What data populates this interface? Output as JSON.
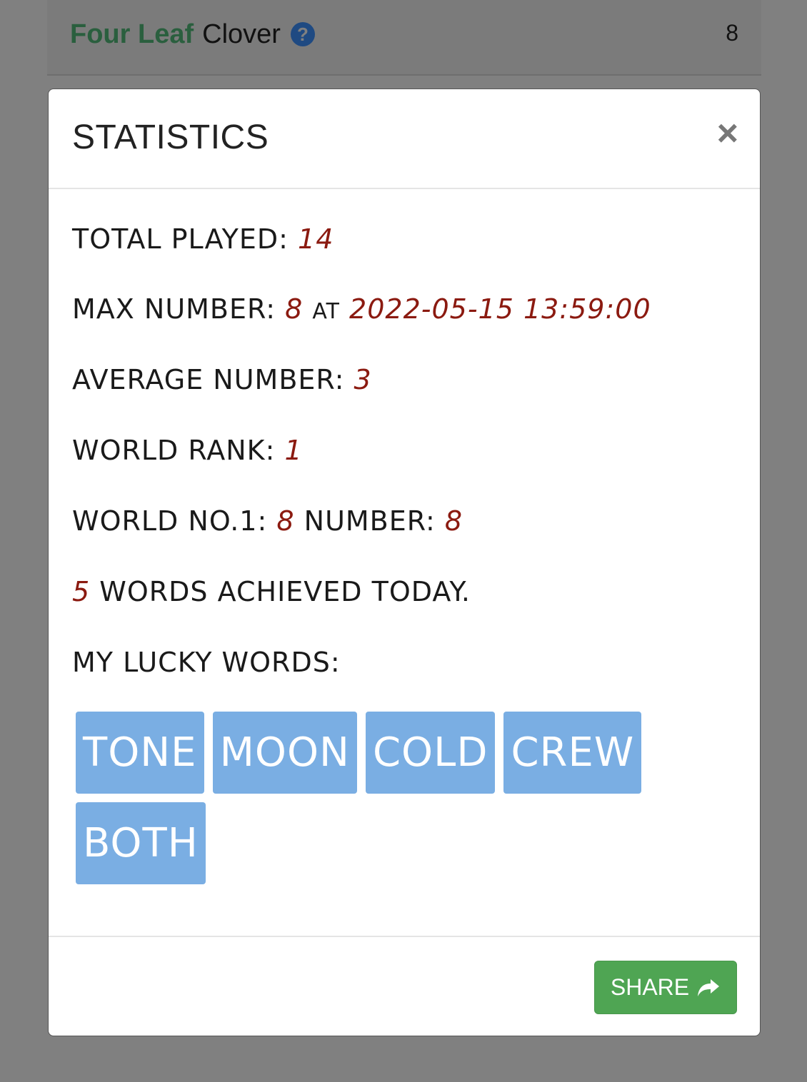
{
  "header": {
    "title_green": "Four Leaf",
    "title_dark": "Clover",
    "help_icon": "question-circle-icon",
    "count": "8"
  },
  "modal": {
    "title": "STATISTICS",
    "close_label": "×",
    "stats": {
      "total_played_label": "Total Played:",
      "total_played_value": "14",
      "max_number_label": "Max Number:",
      "max_number_value": "8",
      "max_number_at": "at",
      "max_number_datetime": "2022-05-15 13:59:00",
      "average_number_label": "Average Number:",
      "average_number_value": "3",
      "world_rank_label": "World Rank:",
      "world_rank_value": "1",
      "world_no1_label": "World No.1:",
      "world_no1_value": "8",
      "world_no1_number_label": "Number:",
      "world_no1_number_value": "8",
      "words_today_value": "5",
      "words_today_label": "Words achieved today.",
      "lucky_words_label": "My Lucky Words:"
    },
    "lucky_words": [
      "Tone",
      "Moon",
      "Cold",
      "Crew",
      "Both"
    ],
    "share_label": "SHARE",
    "share_icon": "share-arrow-icon"
  },
  "colors": {
    "value_red": "#8b1a10",
    "word_blue": "#7aaee3",
    "share_green": "#4fa553",
    "title_green": "#2a5f3e"
  }
}
